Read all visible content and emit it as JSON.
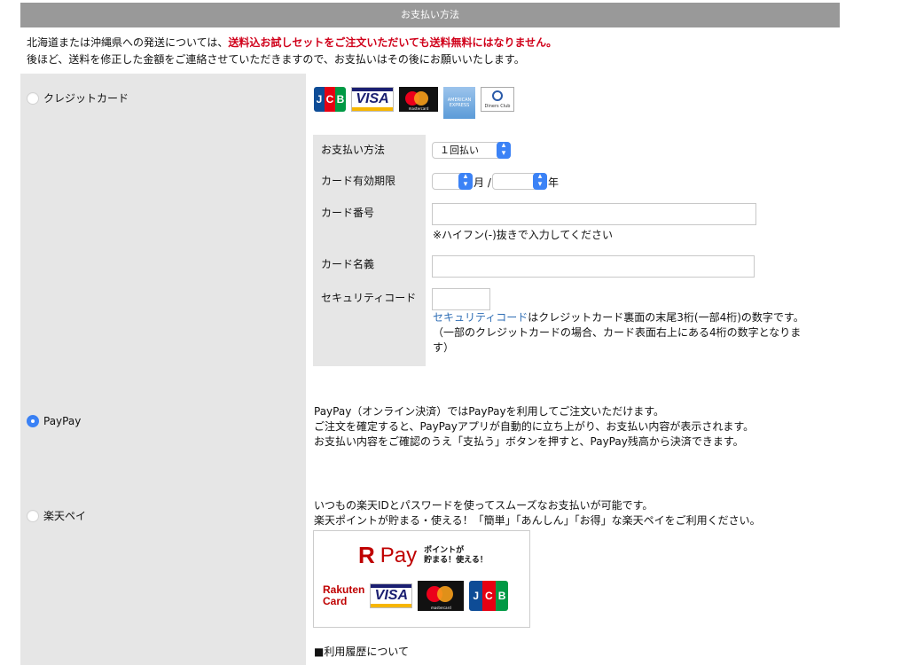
{
  "header": {
    "title": "お支払い方法"
  },
  "notice": {
    "line1_prefix": "北海道または沖縄県への発送については、",
    "line1_red": "送料込お試しセットをご注文いただいても送料無料にはなりません",
    "line1_suffix": "。",
    "line2": "後ほど、送料を修正した金額をご連絡させていただきますので、お支払いはその後にお願いいたします。"
  },
  "methods": {
    "credit": {
      "label": "クレジットカード",
      "checked": false
    },
    "paypay": {
      "label": "PayPay",
      "checked": true
    },
    "rakuten": {
      "label": "楽天ペイ",
      "checked": false
    }
  },
  "card_logos": {
    "jcb": [
      "J",
      "C",
      "B"
    ],
    "visa": "VISA",
    "mastercard": "mastercard",
    "amex": "AMERICAN EXPRESS",
    "diners": "Diners Club"
  },
  "credit_form": {
    "payment_method_label": "お支払い方法",
    "payment_method_value": "１回払い",
    "expiry_label": "カード有効期限",
    "expiry_month_value": "",
    "expiry_month_unit": "月 /",
    "expiry_year_value": "",
    "expiry_year_unit": "年",
    "card_number_label": "カード番号",
    "card_number_value": "",
    "card_number_note": "※ハイフン(-)抜きで入力してください",
    "card_name_label": "カード名義",
    "card_name_value": "",
    "security_label": "セキュリティコード",
    "security_value": "",
    "security_link": "セキュリティコード",
    "security_note_1": "はクレジットカード裏面の末尾3桁(一部4桁)の数字です。",
    "security_note_2": "（一部のクレジットカードの場合、カード表面右上にある4桁の数字となりま",
    "security_note_3": "す）"
  },
  "paypay_desc": {
    "line1": "PayPay（オンライン決済）ではPayPayを利用してご注文いただけます。",
    "line2": "ご注文を確定すると、PayPayアプリが自動的に立ち上がり、お支払い内容が表示されます。",
    "line3": "お支払い内容をご確認のうえ「支払う」ボタンを押すと、PayPay残高から決済できます。"
  },
  "rakuten_desc": {
    "line1": "いつもの楽天IDとパスワードを使ってスムーズなお支払いが可能です。",
    "line2": "楽天ポイントが貯まる・使える！「簡単」「あんしん」「お得」な楽天ペイをご利用ください。",
    "logo_r": "R",
    "logo_pay": "Pay",
    "logo_tag_1": "ポイントが",
    "logo_tag_2": "貯まる！使える！",
    "rakuten_card_1": "Rakuten",
    "rakuten_card_2": "Card",
    "visa": "VISA",
    "mastercard": "mastercard",
    "jcb": [
      "J",
      "C",
      "B"
    ]
  },
  "usage_history": {
    "title": "■利用履歴について"
  },
  "colors": {
    "header_bg": "#999999",
    "accent_blue": "#3b82f6",
    "warning_red": "#d0021b",
    "rakuten_red": "#bf0000"
  }
}
